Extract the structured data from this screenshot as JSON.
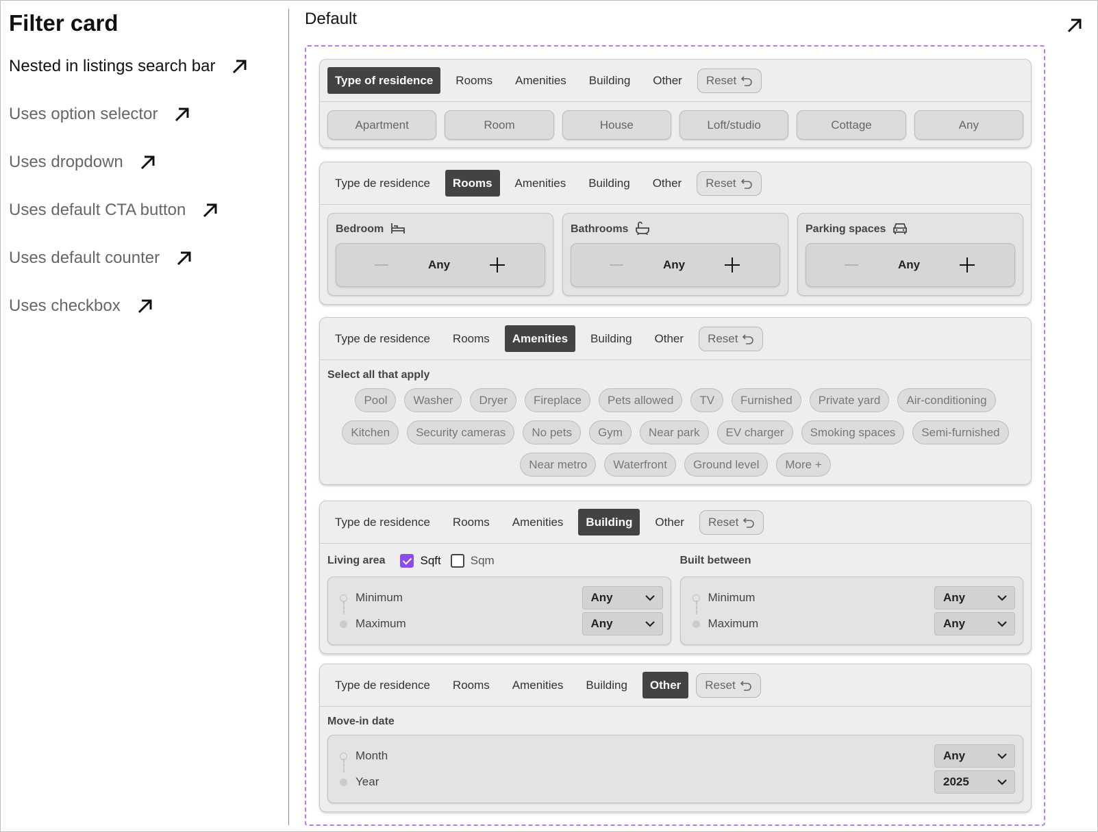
{
  "left": {
    "title": "Filter card",
    "links": [
      {
        "label": "Nested in listings search bar",
        "primary": true
      },
      {
        "label": "Uses option selector"
      },
      {
        "label": "Uses dropdown"
      },
      {
        "label": "Uses default CTA button"
      },
      {
        "label": "Uses default counter"
      },
      {
        "label": "Uses checkbox"
      }
    ]
  },
  "right": {
    "title": "Default"
  },
  "reset_label": "Reset",
  "cards": {
    "type": {
      "tabs": [
        "Type of residence",
        "Rooms",
        "Amenities",
        "Building",
        "Other"
      ],
      "active": 0,
      "options": [
        "Apartment",
        "Room",
        "House",
        "Loft/studio",
        "Cottage",
        "Any"
      ]
    },
    "rooms": {
      "tabs": [
        "Type de residence",
        "Rooms",
        "Amenities",
        "Building",
        "Other"
      ],
      "active": 1,
      "counters": [
        {
          "label": "Bedroom",
          "icon": "bed-icon",
          "value": "Any"
        },
        {
          "label": "Bathrooms",
          "icon": "bathtub-icon",
          "value": "Any"
        },
        {
          "label": "Parking spaces",
          "icon": "car-icon",
          "value": "Any"
        }
      ]
    },
    "amenities": {
      "tabs": [
        "Type de residence",
        "Rooms",
        "Amenities",
        "Building",
        "Other"
      ],
      "active": 2,
      "subtitle": "Select all that apply",
      "chips": [
        "Pool",
        "Washer",
        "Dryer",
        "Fireplace",
        "Pets allowed",
        "TV",
        "Furnished",
        "Private yard",
        "Air-conditioning",
        "Kitchen",
        "Security cameras",
        "No pets",
        "Gym",
        "Near park",
        "EV charger",
        "Smoking spaces",
        "Semi-furnished",
        "Near metro",
        "Waterfront",
        "Ground level",
        "More +"
      ]
    },
    "building": {
      "tabs": [
        "Type de residence",
        "Rooms",
        "Amenities",
        "Building",
        "Other"
      ],
      "active": 3,
      "living_area": {
        "title": "Living area",
        "units": [
          {
            "label": "Sqft",
            "checked": true
          },
          {
            "label": "Sqm",
            "checked": false
          }
        ],
        "min_label": "Minimum",
        "min_value": "Any",
        "max_label": "Maximum",
        "max_value": "Any"
      },
      "built_between": {
        "title": "Built between",
        "min_label": "Minimum",
        "min_value": "Any",
        "max_label": "Maximum",
        "max_value": "Any"
      }
    },
    "other": {
      "tabs": [
        "Type de residence",
        "Rooms",
        "Amenities",
        "Building",
        "Other"
      ],
      "active": 4,
      "subtitle": "Move-in date",
      "month_label": "Month",
      "month_value": "Any",
      "year_label": "Year",
      "year_value": "2025"
    }
  },
  "colors": {
    "accent": "#8a4cec",
    "active_tab": "#434343",
    "dashed_border": "#b57af0"
  }
}
